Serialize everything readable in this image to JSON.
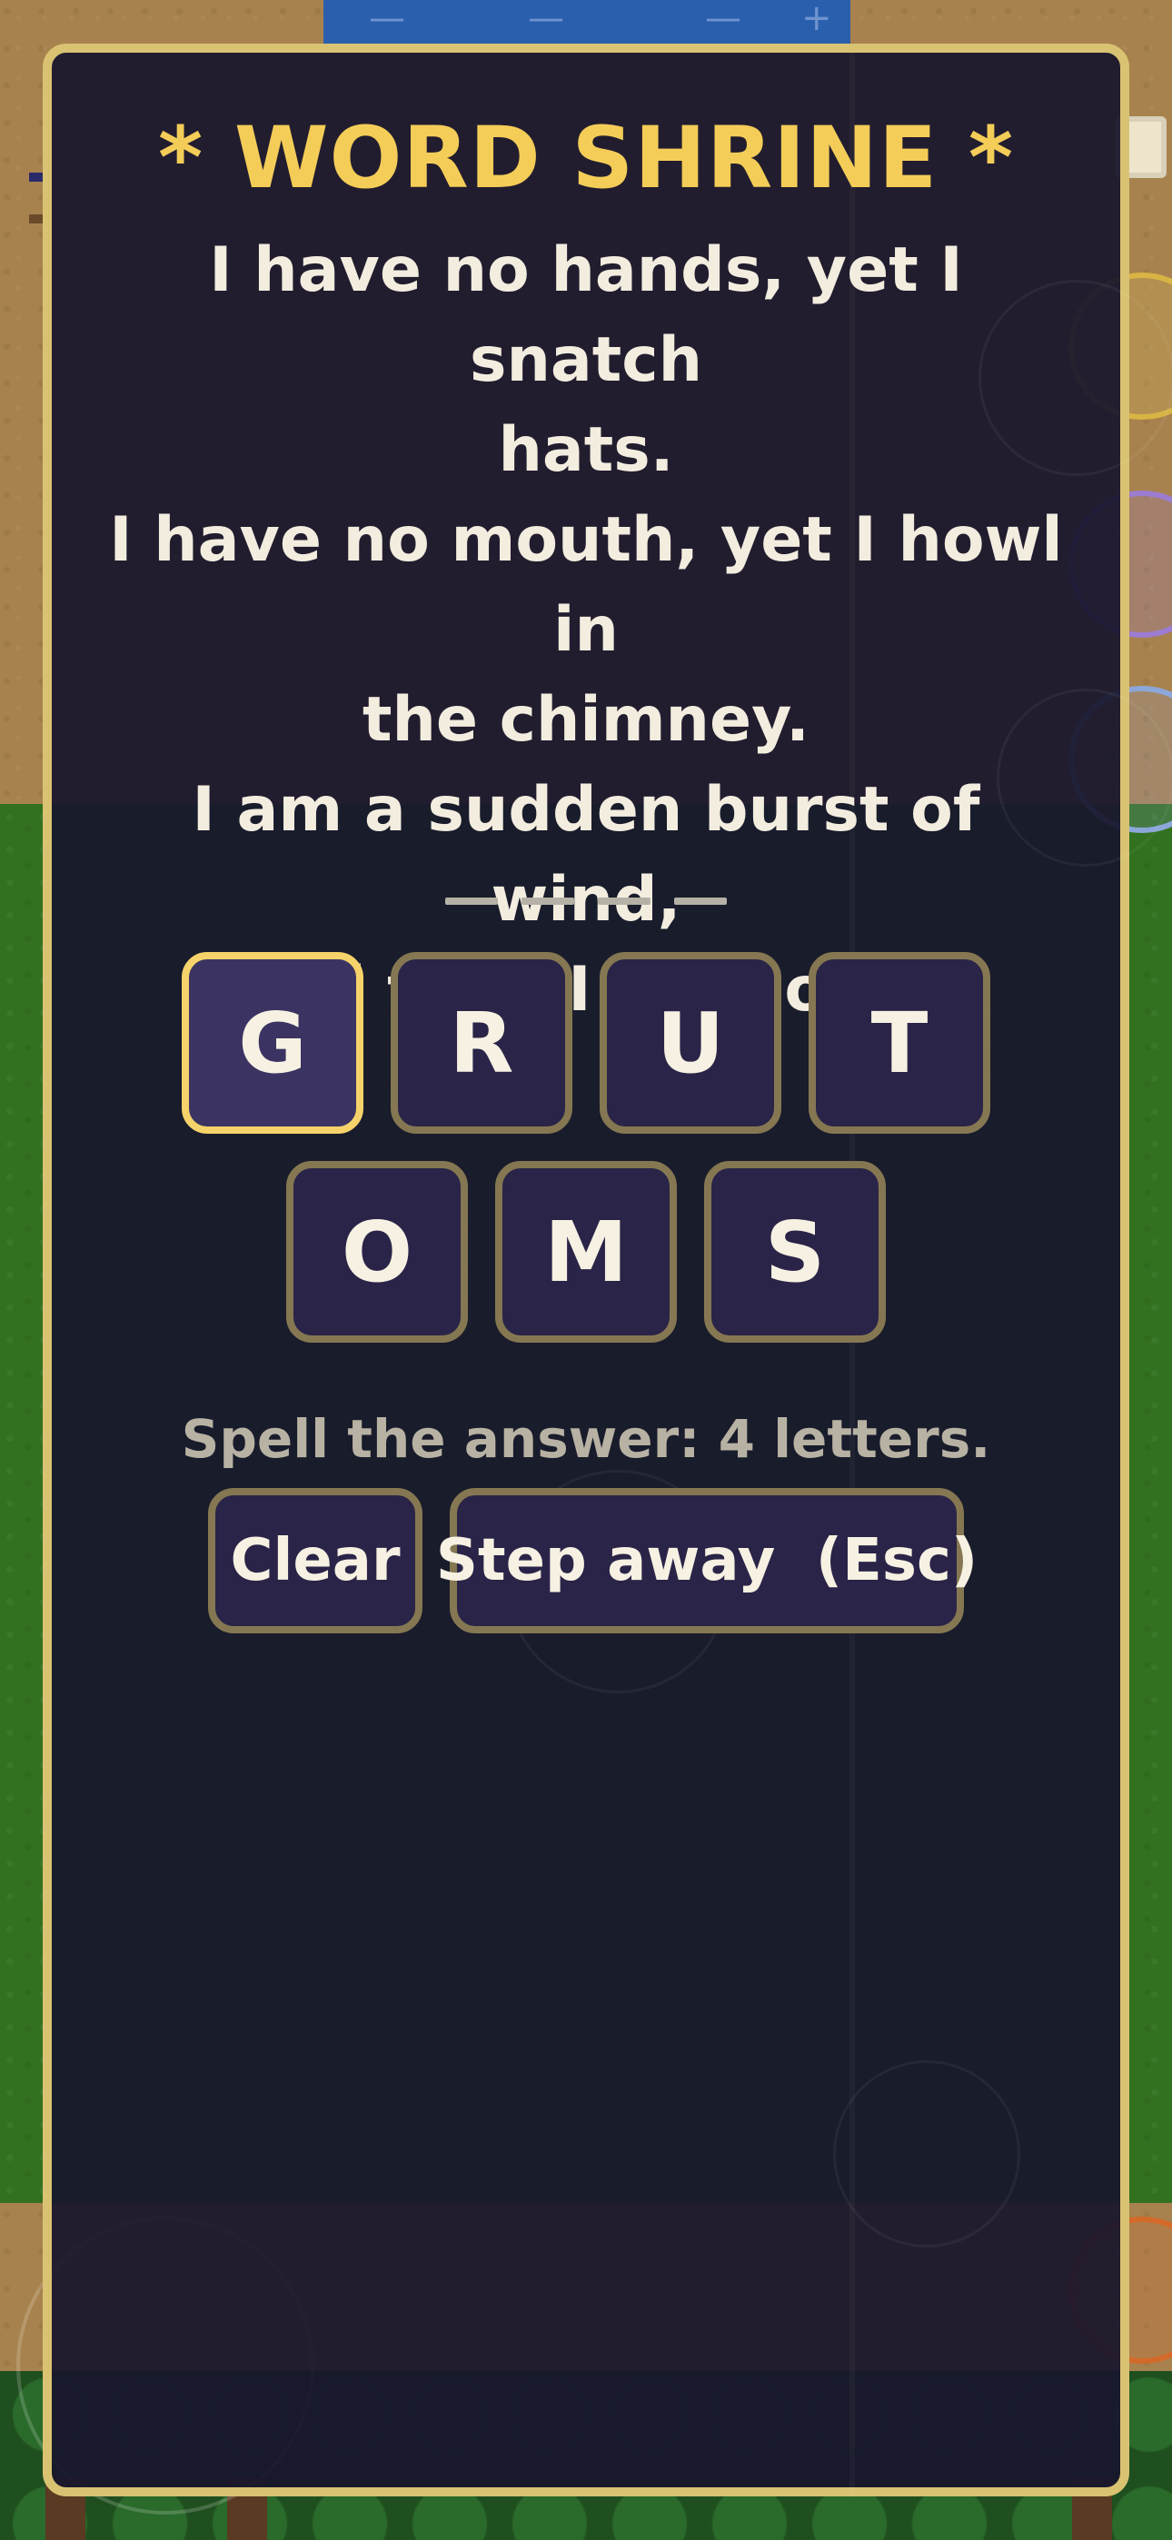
{
  "background": {
    "colors": {
      "sand": "#a8824e",
      "grass": "#32711f",
      "water": "#2a5fae"
    }
  },
  "modal": {
    "border_color": "#d9c373",
    "title": "* WORD SHRINE *",
    "riddle_lines": [
      "I have no hands, yet I snatch",
      "hats.",
      "I have no mouth, yet I howl in",
      "the chimney.",
      "I am a sudden burst of wind,",
      "and then I am gone."
    ],
    "answer_length": 4,
    "letters_row1": [
      "G",
      "R",
      "U",
      "T"
    ],
    "letters_row2": [
      "O",
      "M",
      "S"
    ],
    "selected_letter": "G",
    "hint": "Spell the answer: 4 letters.",
    "clear_label": "Clear",
    "step_away_label": "Step away  (Esc)"
  }
}
